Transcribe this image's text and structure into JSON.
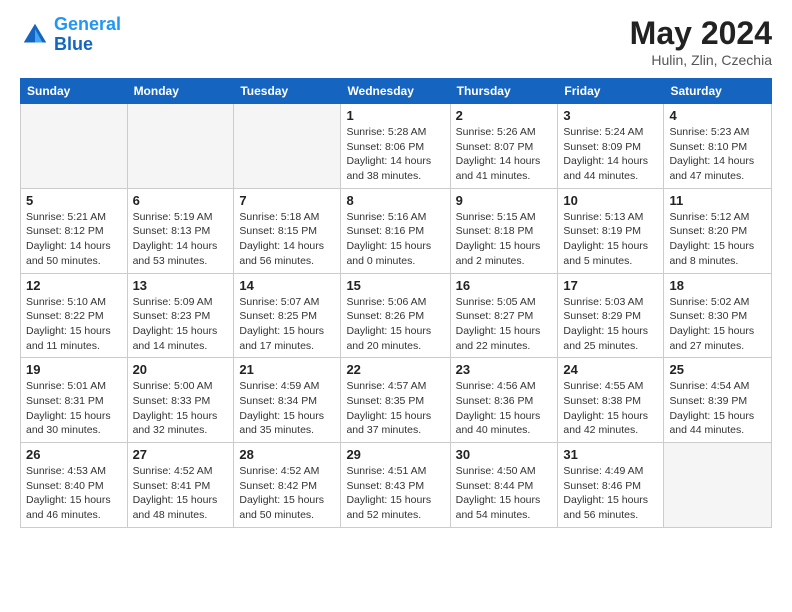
{
  "header": {
    "logo_line1": "General",
    "logo_line2": "Blue",
    "month": "May 2024",
    "location": "Hulin, Zlin, Czechia"
  },
  "weekdays": [
    "Sunday",
    "Monday",
    "Tuesday",
    "Wednesday",
    "Thursday",
    "Friday",
    "Saturday"
  ],
  "weeks": [
    [
      {
        "day": "",
        "info": ""
      },
      {
        "day": "",
        "info": ""
      },
      {
        "day": "",
        "info": ""
      },
      {
        "day": "1",
        "info": "Sunrise: 5:28 AM\nSunset: 8:06 PM\nDaylight: 14 hours\nand 38 minutes."
      },
      {
        "day": "2",
        "info": "Sunrise: 5:26 AM\nSunset: 8:07 PM\nDaylight: 14 hours\nand 41 minutes."
      },
      {
        "day": "3",
        "info": "Sunrise: 5:24 AM\nSunset: 8:09 PM\nDaylight: 14 hours\nand 44 minutes."
      },
      {
        "day": "4",
        "info": "Sunrise: 5:23 AM\nSunset: 8:10 PM\nDaylight: 14 hours\nand 47 minutes."
      }
    ],
    [
      {
        "day": "5",
        "info": "Sunrise: 5:21 AM\nSunset: 8:12 PM\nDaylight: 14 hours\nand 50 minutes."
      },
      {
        "day": "6",
        "info": "Sunrise: 5:19 AM\nSunset: 8:13 PM\nDaylight: 14 hours\nand 53 minutes."
      },
      {
        "day": "7",
        "info": "Sunrise: 5:18 AM\nSunset: 8:15 PM\nDaylight: 14 hours\nand 56 minutes."
      },
      {
        "day": "8",
        "info": "Sunrise: 5:16 AM\nSunset: 8:16 PM\nDaylight: 15 hours\nand 0 minutes."
      },
      {
        "day": "9",
        "info": "Sunrise: 5:15 AM\nSunset: 8:18 PM\nDaylight: 15 hours\nand 2 minutes."
      },
      {
        "day": "10",
        "info": "Sunrise: 5:13 AM\nSunset: 8:19 PM\nDaylight: 15 hours\nand 5 minutes."
      },
      {
        "day": "11",
        "info": "Sunrise: 5:12 AM\nSunset: 8:20 PM\nDaylight: 15 hours\nand 8 minutes."
      }
    ],
    [
      {
        "day": "12",
        "info": "Sunrise: 5:10 AM\nSunset: 8:22 PM\nDaylight: 15 hours\nand 11 minutes."
      },
      {
        "day": "13",
        "info": "Sunrise: 5:09 AM\nSunset: 8:23 PM\nDaylight: 15 hours\nand 14 minutes."
      },
      {
        "day": "14",
        "info": "Sunrise: 5:07 AM\nSunset: 8:25 PM\nDaylight: 15 hours\nand 17 minutes."
      },
      {
        "day": "15",
        "info": "Sunrise: 5:06 AM\nSunset: 8:26 PM\nDaylight: 15 hours\nand 20 minutes."
      },
      {
        "day": "16",
        "info": "Sunrise: 5:05 AM\nSunset: 8:27 PM\nDaylight: 15 hours\nand 22 minutes."
      },
      {
        "day": "17",
        "info": "Sunrise: 5:03 AM\nSunset: 8:29 PM\nDaylight: 15 hours\nand 25 minutes."
      },
      {
        "day": "18",
        "info": "Sunrise: 5:02 AM\nSunset: 8:30 PM\nDaylight: 15 hours\nand 27 minutes."
      }
    ],
    [
      {
        "day": "19",
        "info": "Sunrise: 5:01 AM\nSunset: 8:31 PM\nDaylight: 15 hours\nand 30 minutes."
      },
      {
        "day": "20",
        "info": "Sunrise: 5:00 AM\nSunset: 8:33 PM\nDaylight: 15 hours\nand 32 minutes."
      },
      {
        "day": "21",
        "info": "Sunrise: 4:59 AM\nSunset: 8:34 PM\nDaylight: 15 hours\nand 35 minutes."
      },
      {
        "day": "22",
        "info": "Sunrise: 4:57 AM\nSunset: 8:35 PM\nDaylight: 15 hours\nand 37 minutes."
      },
      {
        "day": "23",
        "info": "Sunrise: 4:56 AM\nSunset: 8:36 PM\nDaylight: 15 hours\nand 40 minutes."
      },
      {
        "day": "24",
        "info": "Sunrise: 4:55 AM\nSunset: 8:38 PM\nDaylight: 15 hours\nand 42 minutes."
      },
      {
        "day": "25",
        "info": "Sunrise: 4:54 AM\nSunset: 8:39 PM\nDaylight: 15 hours\nand 44 minutes."
      }
    ],
    [
      {
        "day": "26",
        "info": "Sunrise: 4:53 AM\nSunset: 8:40 PM\nDaylight: 15 hours\nand 46 minutes."
      },
      {
        "day": "27",
        "info": "Sunrise: 4:52 AM\nSunset: 8:41 PM\nDaylight: 15 hours\nand 48 minutes."
      },
      {
        "day": "28",
        "info": "Sunrise: 4:52 AM\nSunset: 8:42 PM\nDaylight: 15 hours\nand 50 minutes."
      },
      {
        "day": "29",
        "info": "Sunrise: 4:51 AM\nSunset: 8:43 PM\nDaylight: 15 hours\nand 52 minutes."
      },
      {
        "day": "30",
        "info": "Sunrise: 4:50 AM\nSunset: 8:44 PM\nDaylight: 15 hours\nand 54 minutes."
      },
      {
        "day": "31",
        "info": "Sunrise: 4:49 AM\nSunset: 8:46 PM\nDaylight: 15 hours\nand 56 minutes."
      },
      {
        "day": "",
        "info": ""
      }
    ]
  ]
}
